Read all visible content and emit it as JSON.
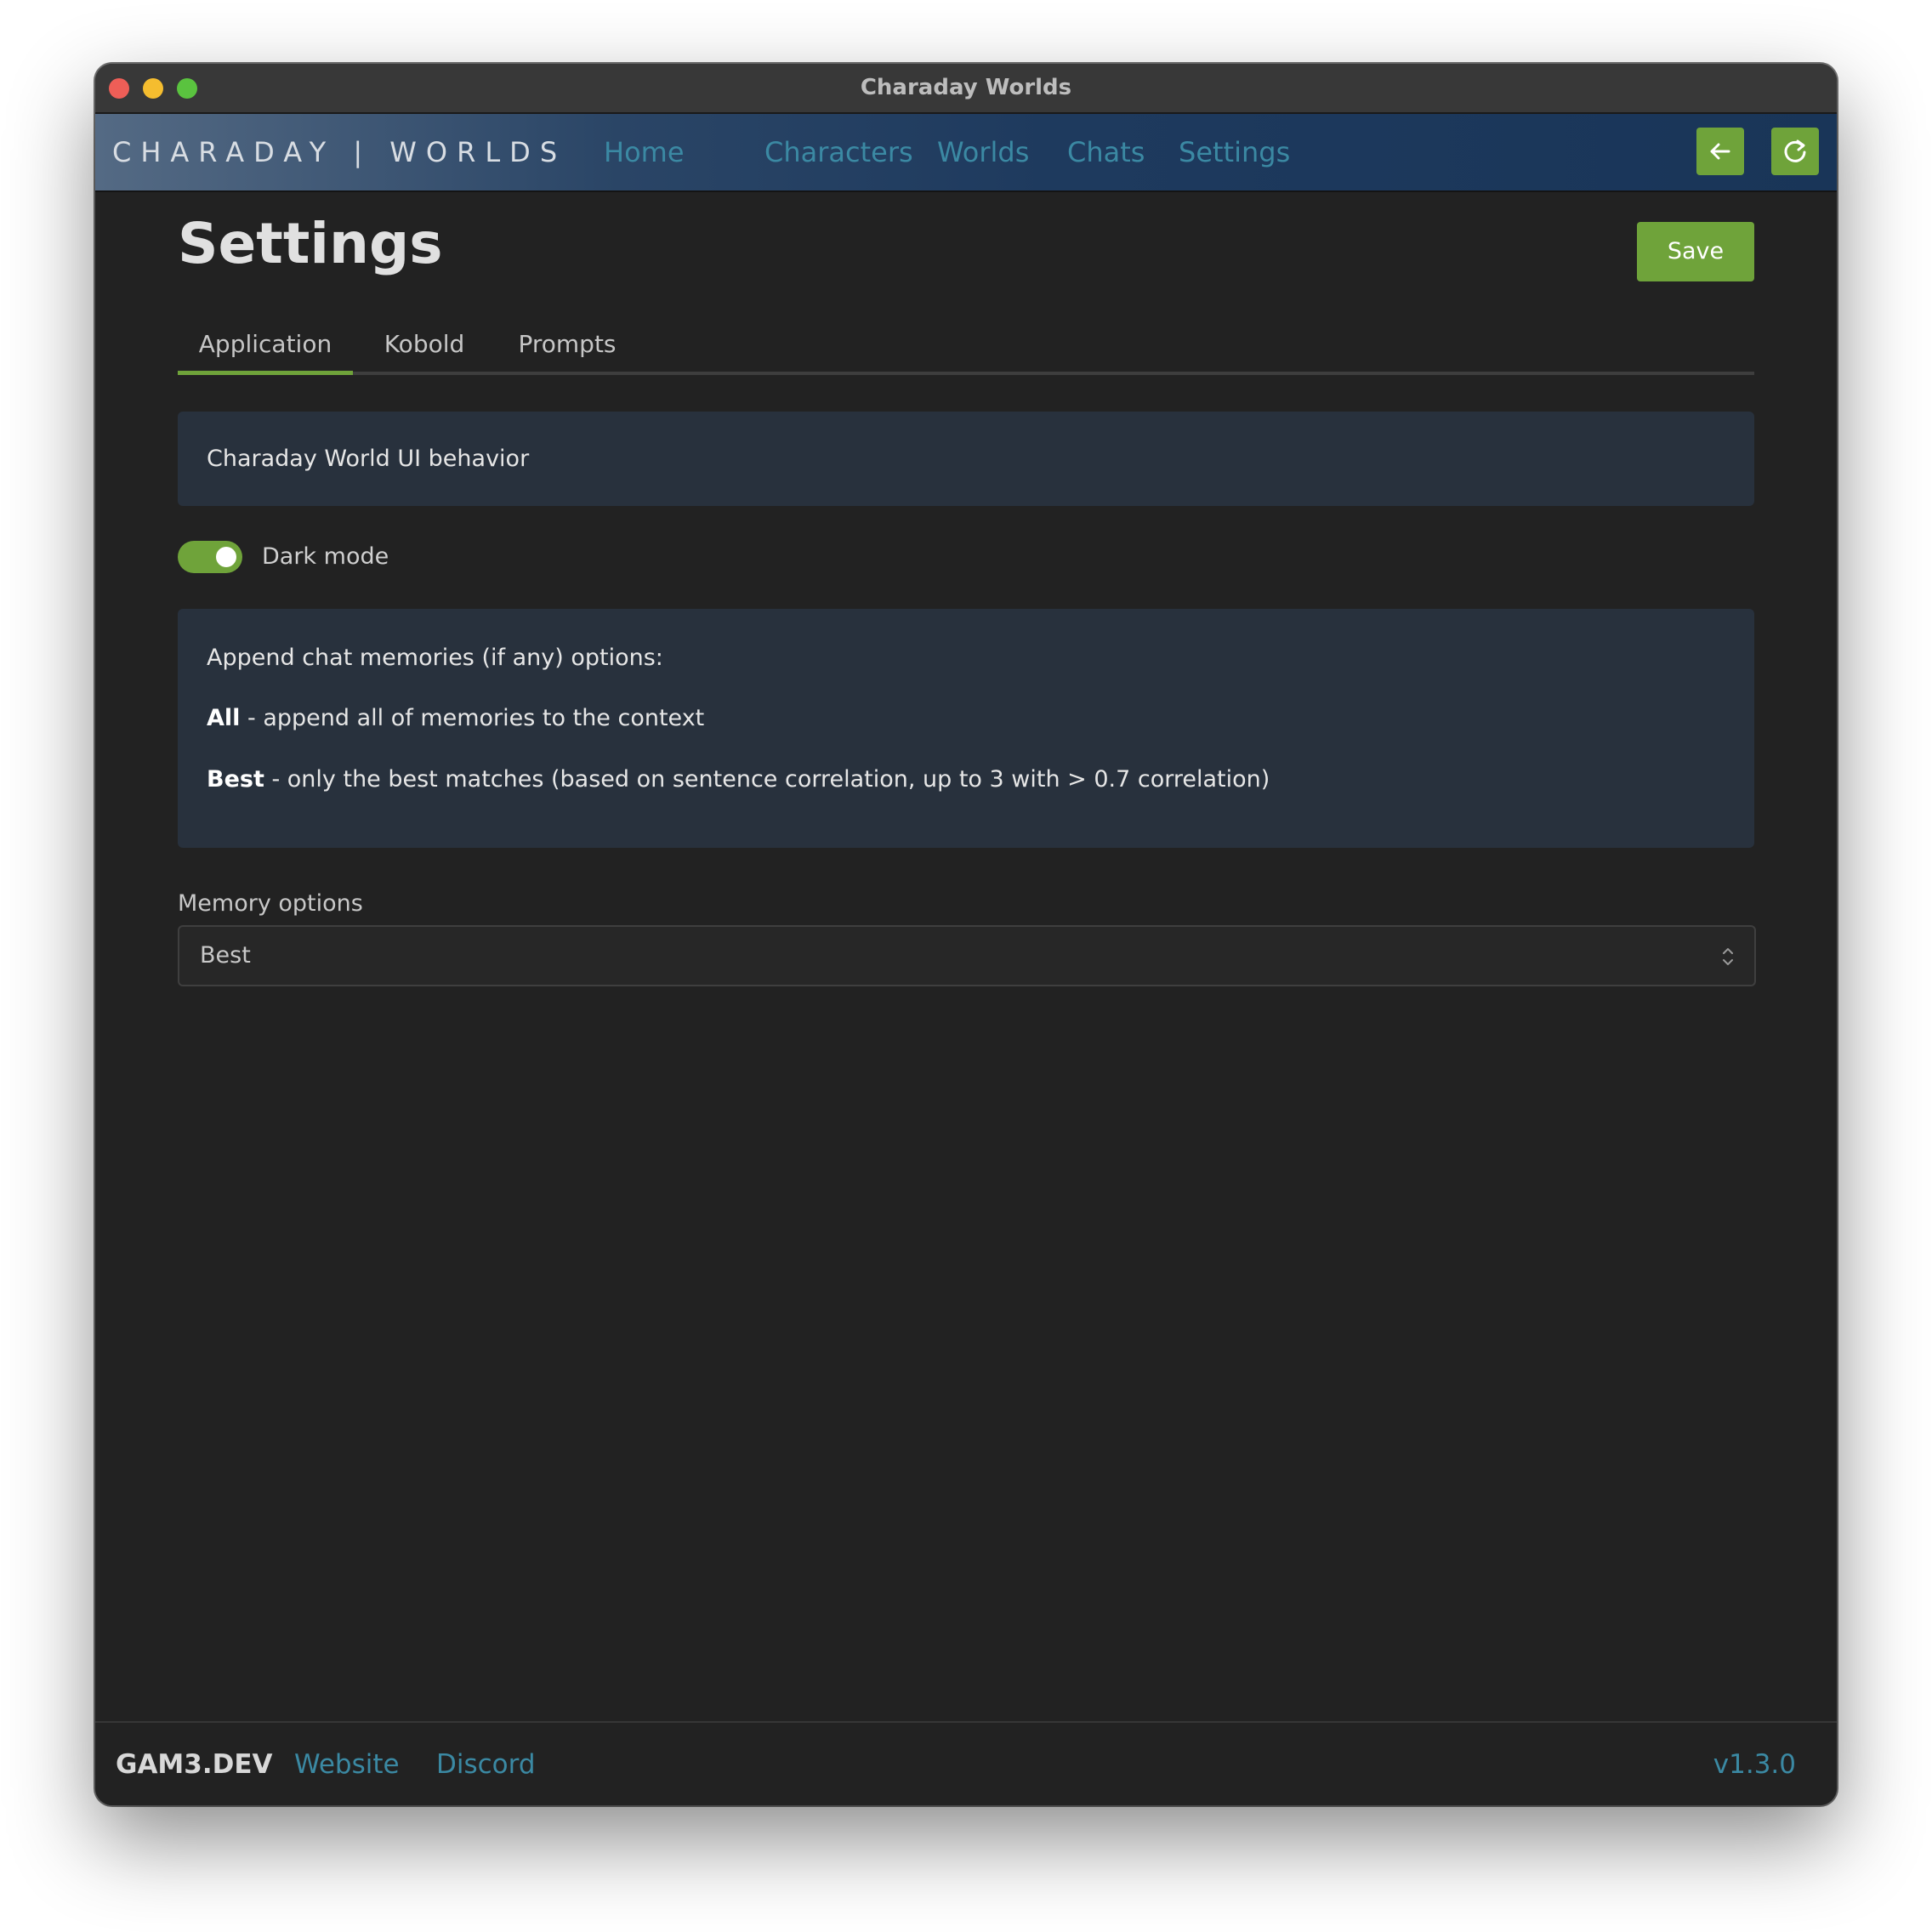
{
  "window": {
    "title": "Charaday Worlds"
  },
  "navbar": {
    "brand": "CHARADAY | WORLDS",
    "links": [
      "Home",
      "Characters",
      "Worlds",
      "Chats",
      "Settings"
    ],
    "back_icon": "arrow-left-icon",
    "refresh_icon": "refresh-icon"
  },
  "page": {
    "title": "Settings",
    "save_label": "Save",
    "tabs": [
      "Application",
      "Kobold",
      "Prompts"
    ],
    "active_tab": "Application"
  },
  "application": {
    "ui_behavior_heading": "Charaday World UI behavior",
    "dark_mode_label": "Dark mode",
    "dark_mode_enabled": true,
    "memories_info": {
      "intro": "Append chat memories (if any) options:",
      "all_term": "All",
      "all_desc": " - append all of memories to the context",
      "best_term": "Best",
      "best_desc": " - only the best matches (based on sentence correlation, up to 3 with > 0.7 correlation)"
    },
    "memory_options_label": "Memory options",
    "memory_options_value": "Best"
  },
  "footer": {
    "brand": "GAM3.DEV",
    "website_label": "Website",
    "discord_label": "Discord",
    "version": "v1.3.0"
  },
  "colors": {
    "accent_green": "#6fa33a",
    "link_teal": "#3b89a3",
    "panel_bg": "#28313d",
    "page_bg": "#222222"
  }
}
